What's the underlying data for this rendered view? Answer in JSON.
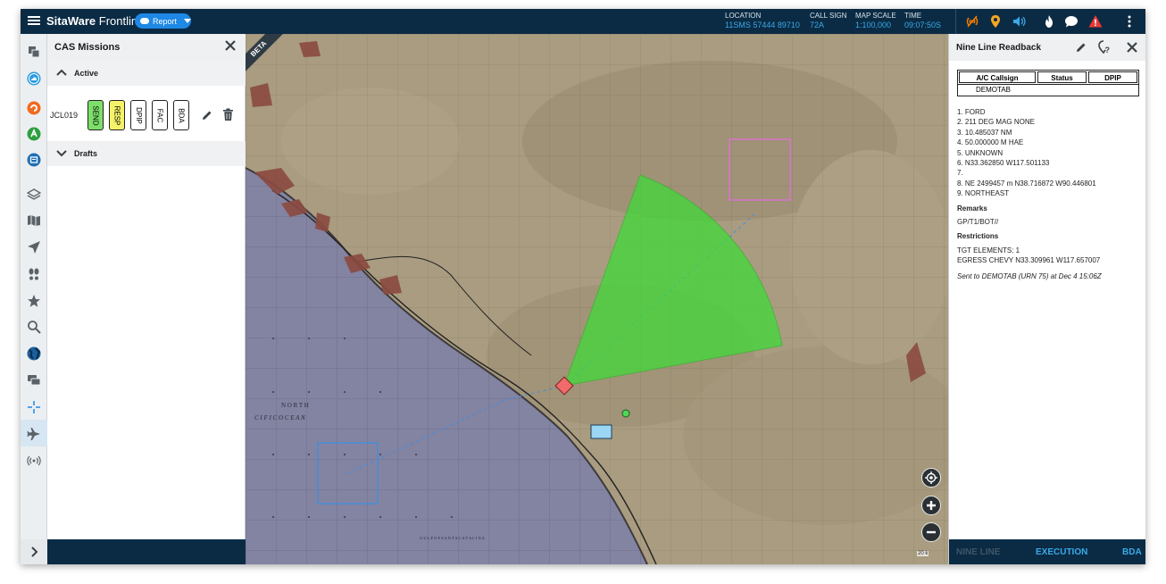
{
  "topbar": {
    "brand_bold": "SitaWare",
    "brand_light": "Frontline",
    "report_label": "Report",
    "location_label": "LOCATION",
    "location_value": "11SMS 57444 89710",
    "callsign_label": "CALL SIGN",
    "callsign_value": "72A",
    "scale_label": "MAP SCALE",
    "scale_value": "1:100,000",
    "time_label": "TIME",
    "time_value": "09:07:50S",
    "icons": [
      "signal-off-icon",
      "location-pin-icon",
      "volume-icon",
      "fire-icon",
      "chat-bubble-icon",
      "alert-icon",
      "more-vertical-icon"
    ],
    "colors": {
      "bar": "#0b2b44",
      "accent": "#39a9e8",
      "signal": "#f57c00",
      "pin": "#f5a623",
      "alert": "#e53935"
    }
  },
  "rail": {
    "icons": [
      "layers-stack-icon",
      "mission-circle-icon",
      "fire-circle-icon",
      "air-circle-icon",
      "message-circle-icon",
      "layers-icon",
      "map-book-icon",
      "navigation-icon",
      "footprints-icon",
      "star-icon",
      "search-icon",
      "globe-icon",
      "chat-icon",
      "crosshair-icon",
      "airplane-icon",
      "radio-icon"
    ]
  },
  "cas": {
    "title": "CAS Missions",
    "active_label": "Active",
    "drafts_label": "Drafts",
    "mission": {
      "id": "JCL019",
      "buttons": [
        {
          "label": "SEND",
          "color": "#7ddf6a"
        },
        {
          "label": "RESP",
          "color": "#f4f26a"
        },
        {
          "label": "DPIP",
          "color": "#ffffff"
        },
        {
          "label": "FAC",
          "color": "#ffffff"
        },
        {
          "label": "BDA",
          "color": "#ffffff"
        }
      ]
    }
  },
  "map": {
    "beta_label": "BETA",
    "scale_text": "20 k",
    "ocean_label_1": "N O R T H",
    "ocean_label_2": "C I F I C   O C E A N",
    "gulf_label": "G U L F   O F   S A N T A   C A T A L I N A",
    "colors": {
      "land": "#a89a7e",
      "water": "#7f7f9e",
      "sector": "#3ddc36",
      "target_box": "#e36fd8",
      "ip_box": "#3f8fe0",
      "friendly": "#9bd7f5",
      "hostile": "#f16b6b"
    }
  },
  "nine": {
    "title": "Nine Line Readback",
    "headers": [
      "A/C Callsign",
      "Status",
      "DPIP"
    ],
    "callsign_value": "DEMOTAB",
    "lines": [
      "1. FORD",
      "2. 211 DEG MAG NONE",
      "3. 10.485037 NM",
      "4. 50.000000 M HAE",
      "5. UNKNOWN",
      "6. N33.362850 W117.501133",
      "7.",
      "8. NE 2499457 m N38.716872 W90.446801",
      "9. NORTHEAST"
    ],
    "remarks_label": "Remarks",
    "remarks_value": "GP/T1/BOT//",
    "restrictions_label": "Restrictions",
    "restrictions_lines": [
      "TGT ELEMENTS: 1",
      "EGRESS CHEVY N33.309961 W117.657007"
    ],
    "sent_text": "Sent to DEMOTAB (URN 75) at Dec 4 15:06Z",
    "tabs": [
      "NINE LINE",
      "EXECUTION",
      "BDA"
    ]
  }
}
